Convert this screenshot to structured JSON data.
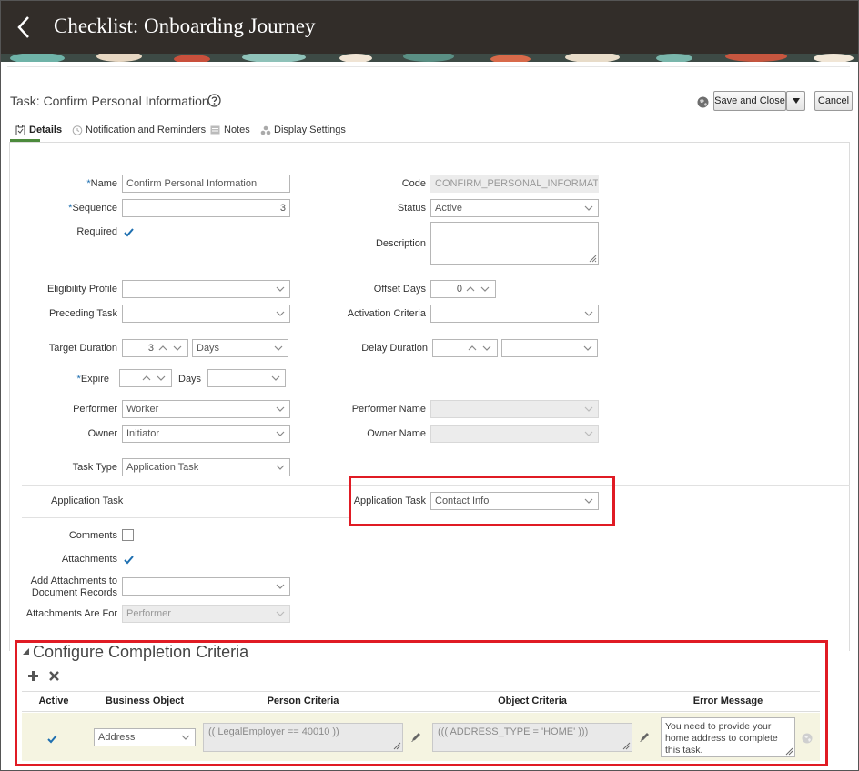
{
  "header": {
    "title": "Checklist: Onboarding Journey"
  },
  "task": {
    "title": "Task: Confirm Personal Information",
    "save_close_label": "Save and Close",
    "cancel_label": "Cancel"
  },
  "tabs": [
    {
      "label": "Details"
    },
    {
      "label": "Notification and Reminders"
    },
    {
      "label": "Notes"
    },
    {
      "label": "Display Settings"
    }
  ],
  "form": {
    "name_label": "Name",
    "name_value": "Confirm Personal Information",
    "sequence_label": "Sequence",
    "sequence_value": "3",
    "required_label": "Required",
    "code_label": "Code",
    "code_value": "CONFIRM_PERSONAL_INFORMATION",
    "status_label": "Status",
    "status_value": "Active",
    "description_label": "Description",
    "eligibility_label": "Eligibility Profile",
    "preceding_label": "Preceding Task",
    "offset_label": "Offset Days",
    "offset_value": "0",
    "activation_label": "Activation Criteria",
    "target_label": "Target Duration",
    "target_value": "3",
    "target_unit": "Days",
    "delay_label": "Delay Duration",
    "expire_label": "Expire",
    "expire_days_label": "Days",
    "performer_label": "Performer",
    "performer_value": "Worker",
    "performer_name_label": "Performer Name",
    "owner_label": "Owner",
    "owner_value": "Initiator",
    "owner_name_label": "Owner Name",
    "task_type_label": "Task Type",
    "task_type_value": "Application Task",
    "app_task_section_label": "Application Task",
    "app_task_label": "Application Task",
    "app_task_value": "Contact Info",
    "comments_label": "Comments",
    "attachments_label": "Attachments",
    "add_attach_label_1": "Add Attachments to",
    "add_attach_label_2": "Document Records",
    "attach_for_label": "Attachments Are For",
    "attach_for_value": "Performer"
  },
  "criteria": {
    "title": "Configure Completion Criteria",
    "columns": [
      "Active",
      "Business Object",
      "Person Criteria",
      "Object Criteria",
      "Error Message"
    ],
    "row": {
      "business_object": "Address",
      "person_criteria": "(( LegalEmployer == 40010 ))",
      "object_criteria": "((( ADDRESS_TYPE = 'HOME' )))",
      "error_message": "You need to provide your home address to complete this task."
    }
  }
}
